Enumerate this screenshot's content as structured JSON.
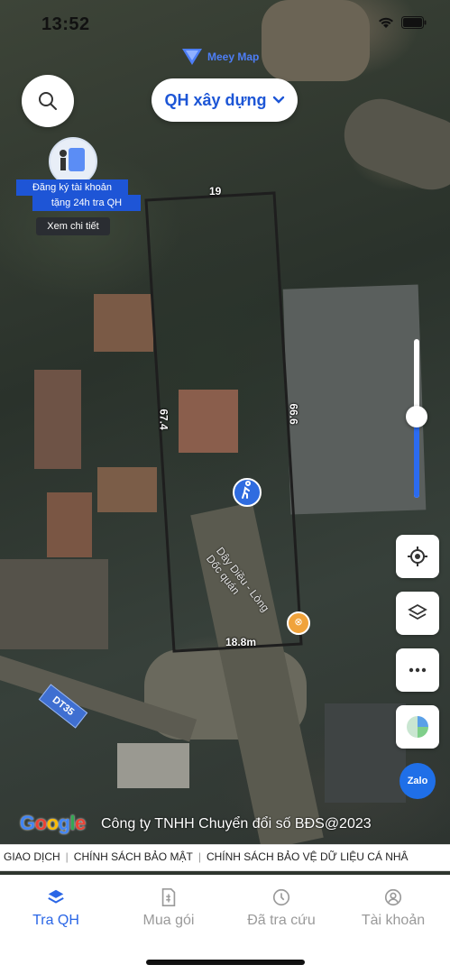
{
  "status_bar": {
    "time": "13:52"
  },
  "brand": {
    "name": "Meey Map"
  },
  "search": {
    "icon": "search-icon"
  },
  "layer_selector": {
    "label": "QH xây dựng"
  },
  "promo": {
    "line1": "Đăng ký tài khoản",
    "line2": "tặng 24h tra QH",
    "detail": "Xem chi tiết"
  },
  "parcel": {
    "top_edge": "19",
    "left_edge": "67.4",
    "right_edge": "66.6",
    "bottom_edge": "18.8m"
  },
  "map_labels": {
    "road": "DT35",
    "poi": "Dây Diều - Lòng Dốc quán"
  },
  "controls": {
    "locate_icon": "crosshair-icon",
    "layers_icon": "layers-icon",
    "more_icon": "more-icon",
    "chart_icon": "pie-chart-icon",
    "zalo_label": "Zalo"
  },
  "attribution": {
    "google": "Google",
    "copyright": "Công ty TNHH Chuyển đổi số BĐS@2023"
  },
  "policies": [
    "N GIAO DỊCH",
    "CHÍNH SÁCH BẢO MẬT",
    "CHÍNH SÁCH BẢO VỆ DỮ LIỆU CÁ NHÂ"
  ],
  "tabs": [
    {
      "label": "Tra QH",
      "icon": "layers-stack-icon",
      "active": true
    },
    {
      "label": "Mua gói",
      "icon": "invoice-icon",
      "active": false
    },
    {
      "label": "Đã tra cứu",
      "icon": "clock-icon",
      "active": false
    },
    {
      "label": "Tài khoản",
      "icon": "user-circle-icon",
      "active": false
    }
  ],
  "colors": {
    "accent": "#2a66e6",
    "parcel_outline": "#1e1e1e"
  }
}
